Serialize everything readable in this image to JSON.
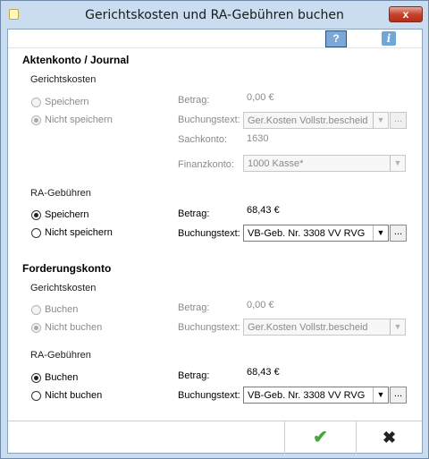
{
  "window": {
    "title": "Gerichtskosten und RA-Gebühren buchen",
    "close_symbol": "x"
  },
  "help": {
    "help_symbol": "?",
    "info_symbol": "i"
  },
  "akten": {
    "title": "Aktenkonto / Journal",
    "gk": {
      "title": "Gerichtskosten",
      "radio1": "Speichern",
      "radio2": "Nicht speichern",
      "selected": "radio2",
      "betrag_label": "Betrag:",
      "betrag_value": "0,00 €",
      "buchungstext_label": "Buchungstext:",
      "buchungstext_value": "Ger.Kosten Vollstr.bescheid",
      "sachkonto_label": "Sachkonto:",
      "sachkonto_value": "1630",
      "finanzkonto_label": "Finanzkonto:",
      "finanzkonto_value": "1000 Kasse*"
    },
    "ra": {
      "title": "RA-Gebühren",
      "radio1": "Speichern",
      "radio2": "Nicht speichern",
      "selected": "radio1",
      "betrag_label": "Betrag:",
      "betrag_value": "68,43 €",
      "buchungstext_label": "Buchungstext:",
      "buchungstext_value": "VB-Geb. Nr. 3308 VV RVG"
    }
  },
  "forderung": {
    "title": "Forderungskonto",
    "gk": {
      "title": "Gerichtskosten",
      "radio1": "Buchen",
      "radio2": "Nicht buchen",
      "selected": "radio2",
      "betrag_label": "Betrag:",
      "betrag_value": "0,00 €",
      "buchungstext_label": "Buchungstext:",
      "buchungstext_value": "Ger.Kosten Vollstr.bescheid"
    },
    "ra": {
      "title": "RA-Gebühren",
      "radio1": "Buchen",
      "radio2": "Nicht buchen",
      "selected": "radio1",
      "betrag_label": "Betrag:",
      "betrag_value": "68,43 €",
      "buchungstext_label": "Buchungstext:",
      "buchungstext_value": "VB-Geb. Nr. 3308 VV RVG"
    }
  },
  "common": {
    "arrow": "▼",
    "dots": "...",
    "ok_symbol": "✔",
    "cancel_symbol": "✖"
  },
  "colors": {
    "ok_green": "#4aa43f",
    "title_blue": "#c9dcf0"
  }
}
